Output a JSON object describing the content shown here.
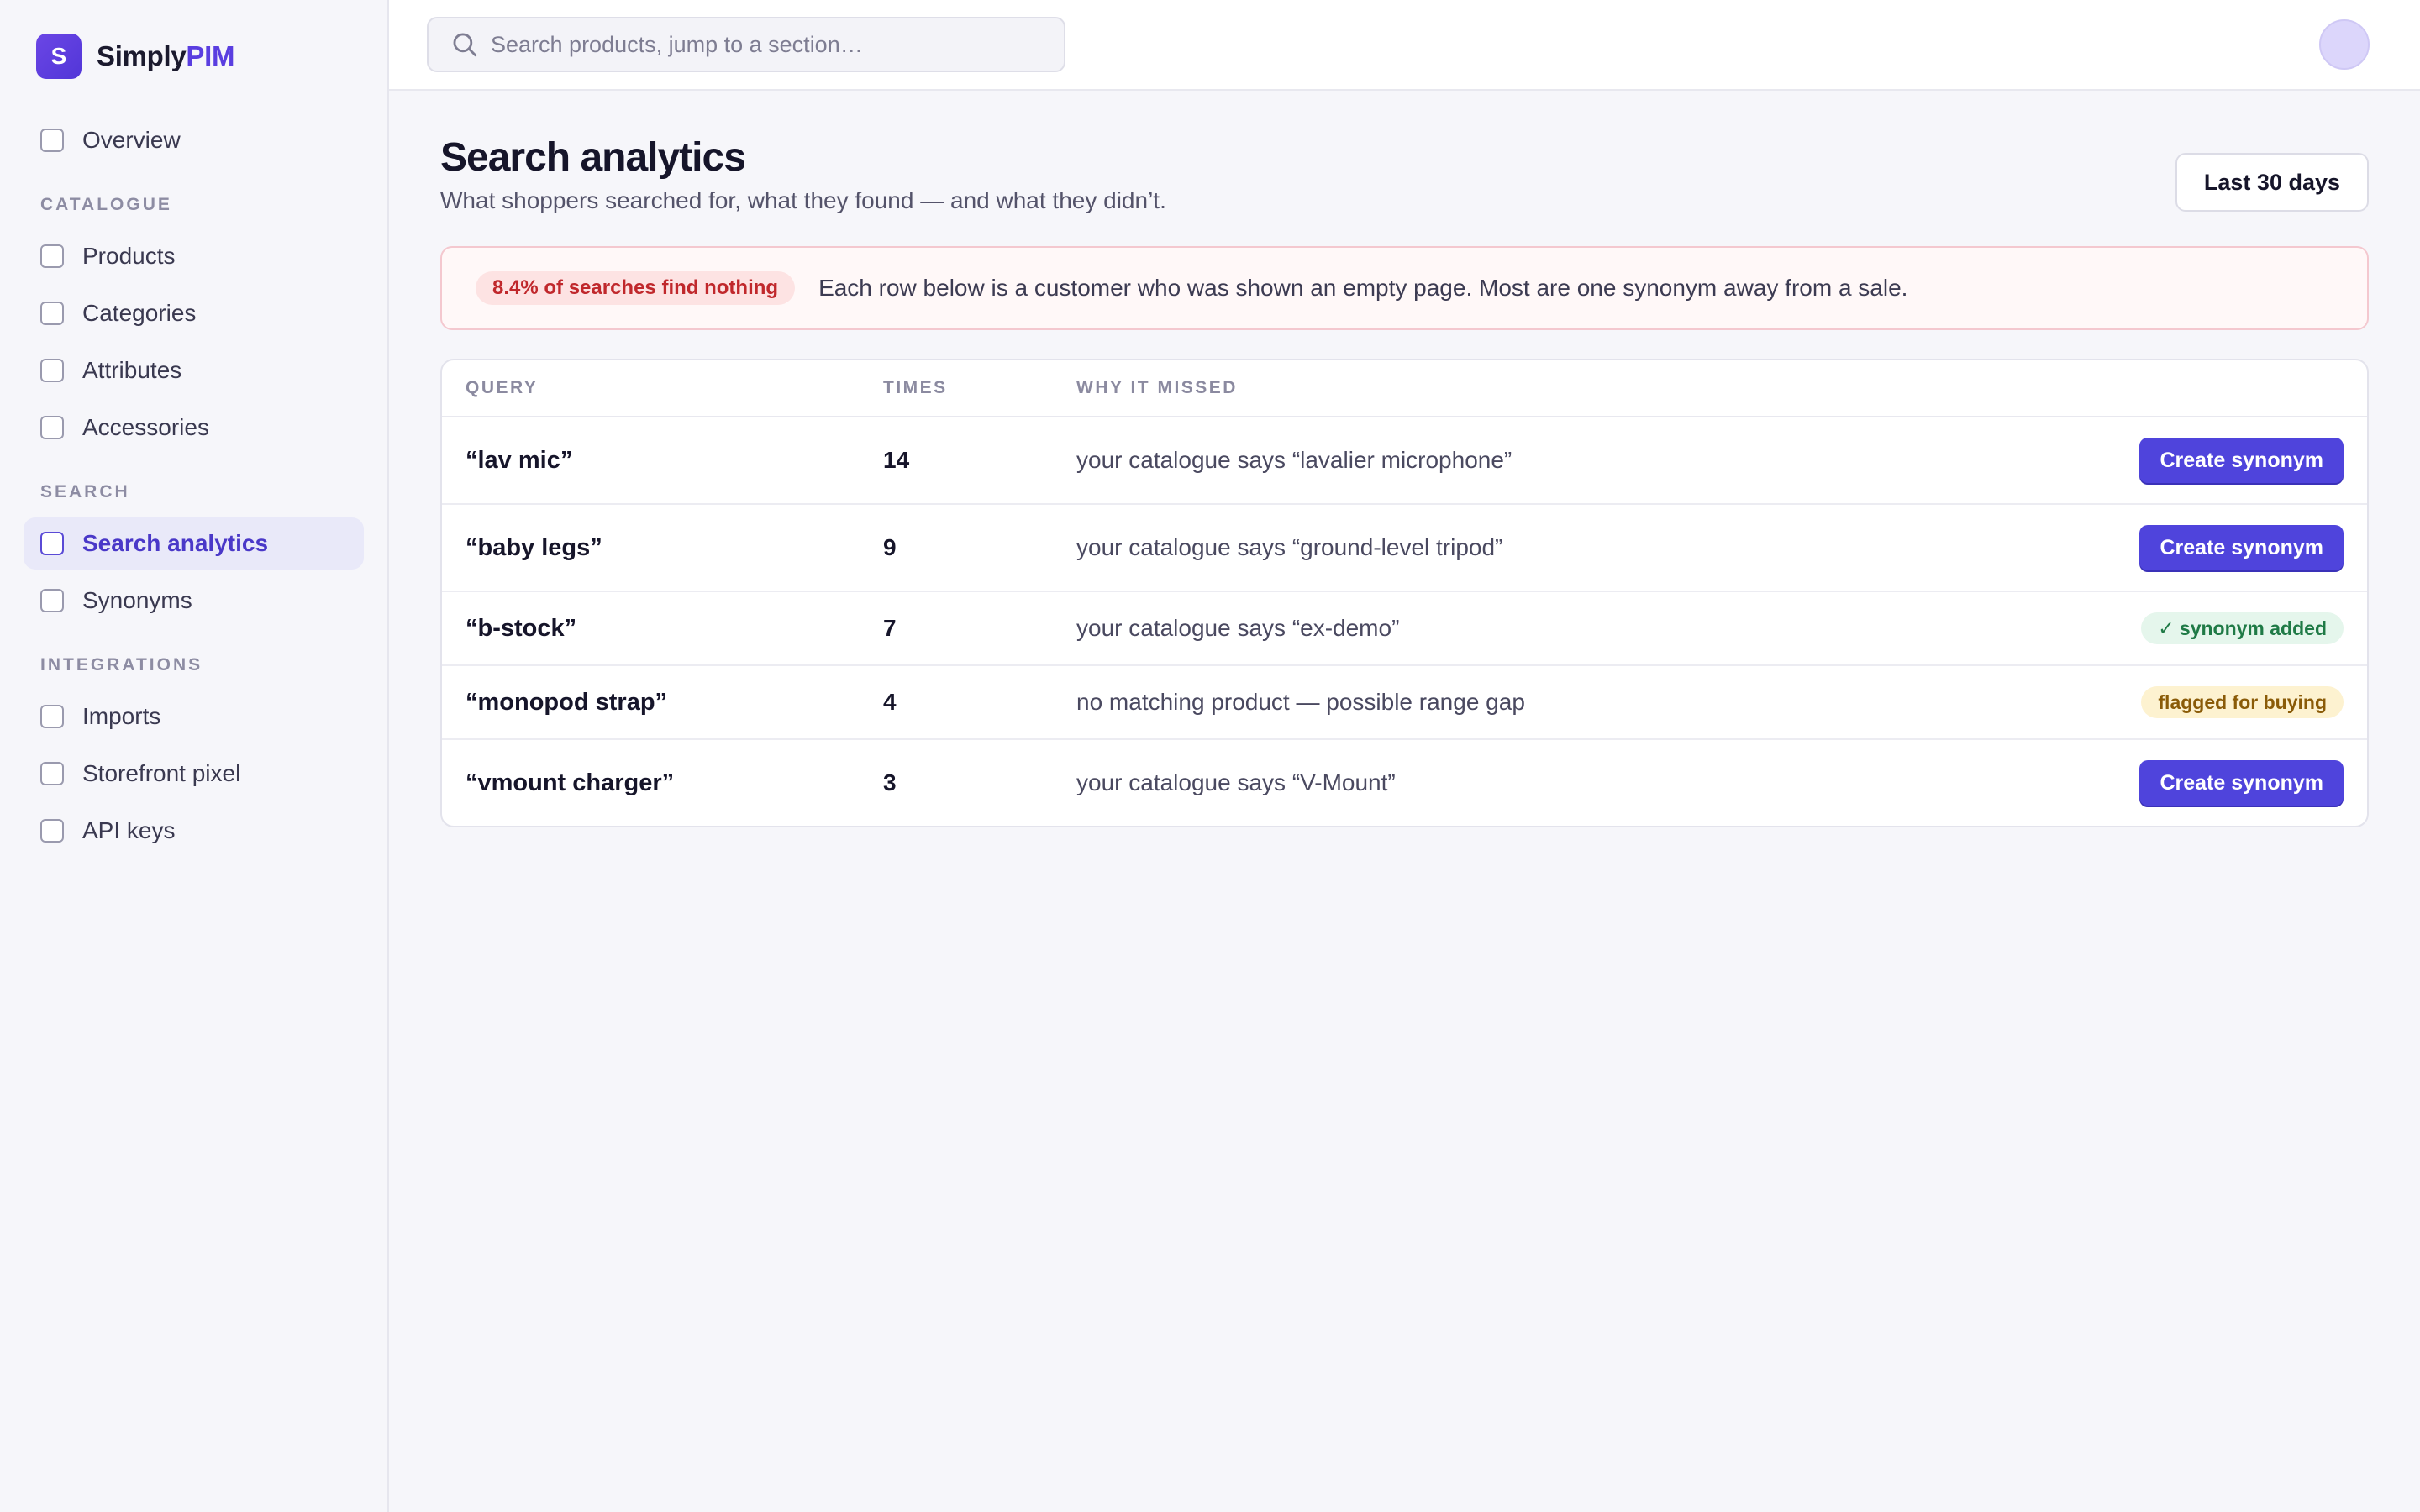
{
  "brand": {
    "logo_letter": "S",
    "name_part1": "Simply",
    "name_part2": "PIM"
  },
  "sidebar": {
    "top_items": [
      {
        "label": "Overview"
      }
    ],
    "sections": [
      {
        "label": "CATALOGUE",
        "items": [
          {
            "label": "Products"
          },
          {
            "label": "Categories"
          },
          {
            "label": "Attributes"
          },
          {
            "label": "Accessories"
          }
        ]
      },
      {
        "label": "SEARCH",
        "items": [
          {
            "label": "Search analytics",
            "active": true
          },
          {
            "label": "Synonyms"
          }
        ]
      },
      {
        "label": "INTEGRATIONS",
        "items": [
          {
            "label": "Imports"
          },
          {
            "label": "Storefront pixel"
          },
          {
            "label": "API keys"
          }
        ]
      }
    ]
  },
  "topbar": {
    "search_placeholder": "Search products, jump to a section…"
  },
  "page": {
    "title": "Search analytics",
    "subtitle": "What shoppers searched for, what they found — and what they didn’t.",
    "range_button": "Last 30 days"
  },
  "banner": {
    "badge": "8.4% of searches find nothing",
    "text": "Each row below is a customer who was shown an empty page. Most are one synonym away from a sale."
  },
  "table": {
    "headers": {
      "query": "QUERY",
      "times": "TIMES",
      "why": "WHY IT MISSED"
    },
    "rows": [
      {
        "query": "“lav mic”",
        "times": "14",
        "why": "your catalogue says “lavalier microphone”",
        "action_type": "button",
        "action_label": "Create synonym"
      },
      {
        "query": "“baby legs”",
        "times": "9",
        "why": "your catalogue says “ground-level tripod”",
        "action_type": "button",
        "action_label": "Create synonym"
      },
      {
        "query": "“b-stock”",
        "times": "7",
        "why": "your catalogue says “ex-demo”",
        "action_type": "status-green",
        "action_label": "✓ synonym added"
      },
      {
        "query": "“monopod strap”",
        "times": "4",
        "why": "no matching product — possible range gap",
        "action_type": "status-amber",
        "action_label": "flagged for buying"
      },
      {
        "query": "“vmount charger”",
        "times": "3",
        "why": "your catalogue says “V-Mount”",
        "action_type": "button",
        "action_label": "Create synonym"
      }
    ]
  },
  "colors": {
    "accent": "#4f44dc",
    "brand": "#5a3ee0",
    "danger": "#c0282c",
    "success": "#1f7a46",
    "warning": "#8a5b08"
  }
}
